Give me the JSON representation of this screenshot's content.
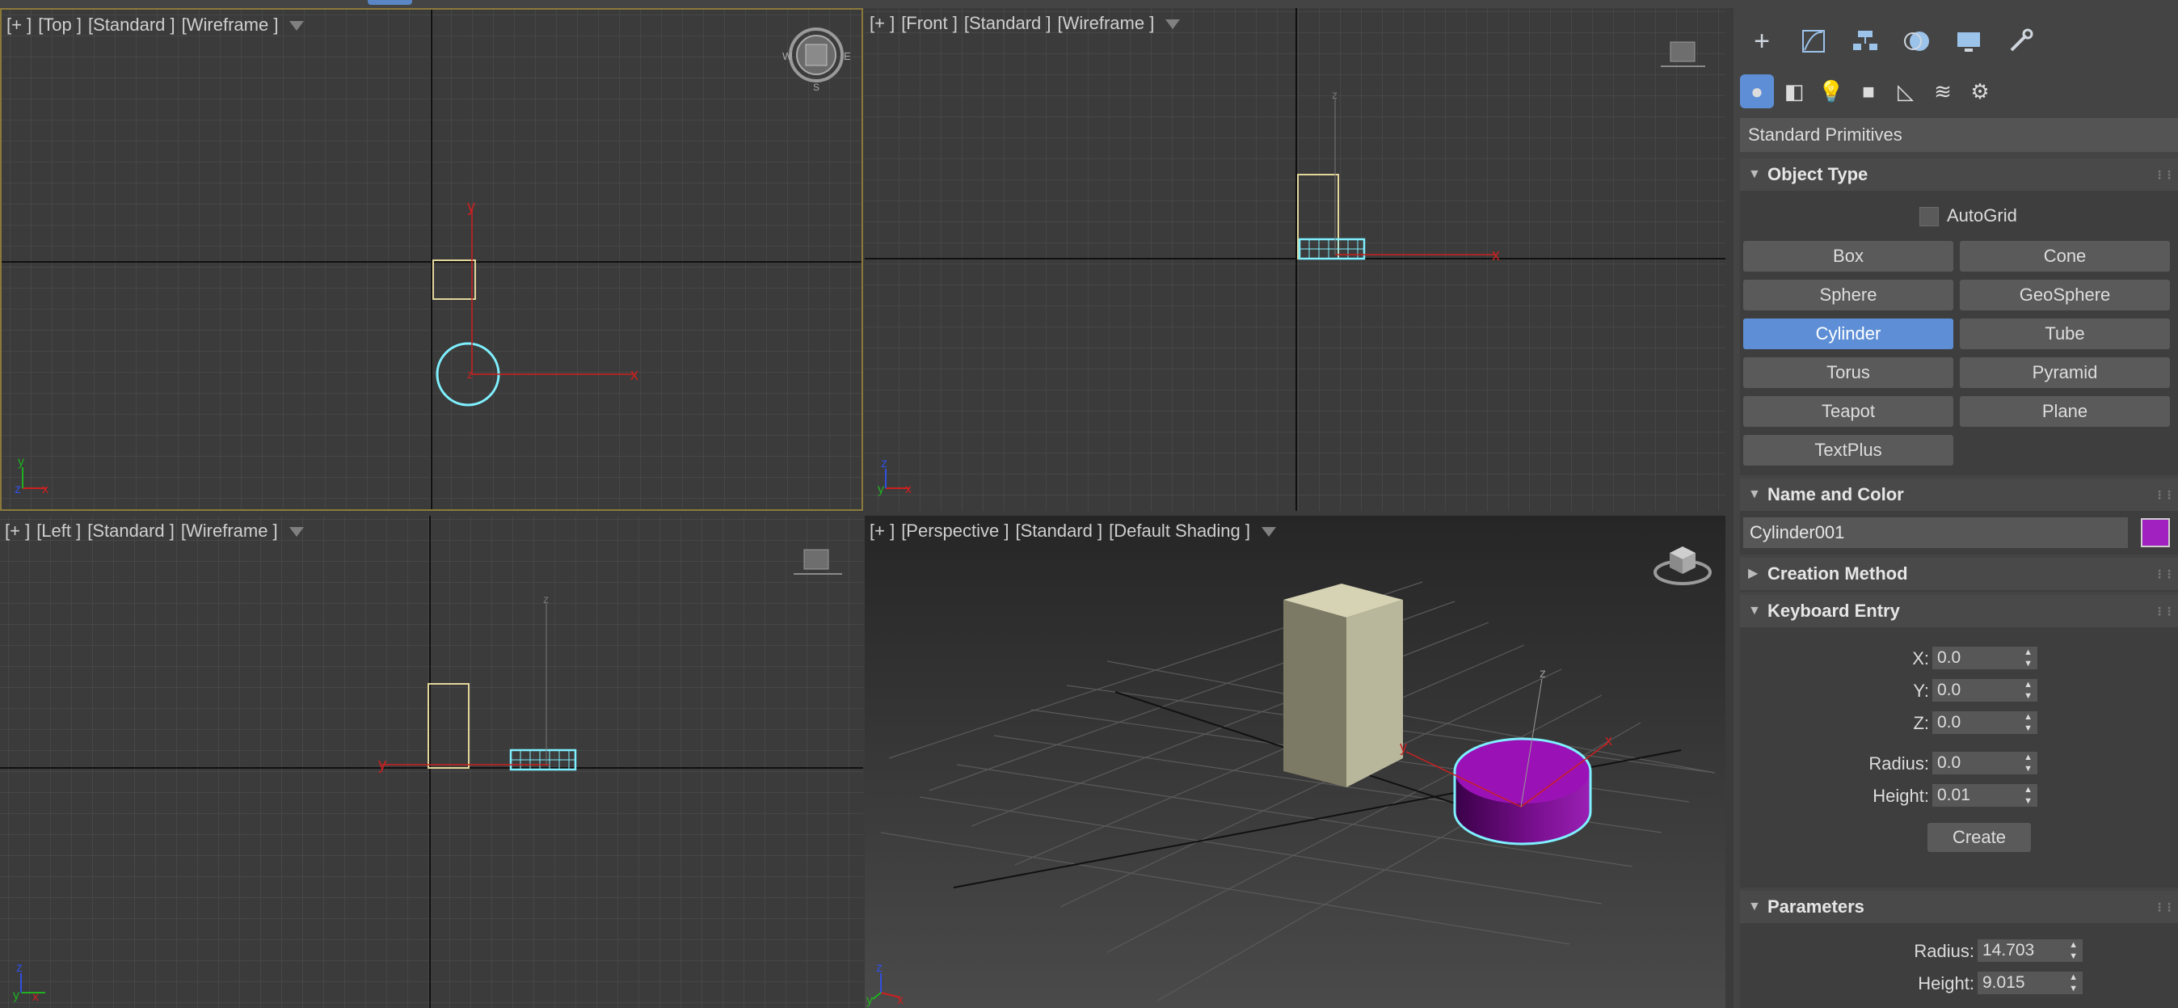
{
  "viewports": {
    "top": {
      "plus": "[+ ]",
      "view": "[Top ]",
      "shading": "[Standard ]",
      "mode": "[Wireframe ]"
    },
    "front": {
      "plus": "[+ ]",
      "view": "[Front ]",
      "shading": "[Standard ]",
      "mode": "[Wireframe ]"
    },
    "left": {
      "plus": "[+ ]",
      "view": "[Left ]",
      "shading": "[Standard ]",
      "mode": "[Wireframe ]"
    },
    "perspective": {
      "plus": "[+ ]",
      "view": "[Perspective ]",
      "shading": "[Standard ]",
      "mode": "[Default Shading ]"
    }
  },
  "axis_labels": {
    "x": "x",
    "y": "y",
    "z": "z"
  },
  "viewcube": {
    "w": "W",
    "e": "E",
    "s": "S"
  },
  "panel": {
    "main_tabs": [
      "create-icon",
      "modify-icon",
      "hierarchy-icon",
      "motion-icon",
      "display-icon",
      "utilities-icon"
    ],
    "sub_tabs": [
      "geometry-icon",
      "shapes-icon",
      "lights-icon",
      "cameras-icon",
      "helpers-icon",
      "space-warps-icon",
      "systems-icon"
    ],
    "category": "Standard Primitives",
    "object_type": {
      "title": "Object Type",
      "autogrid": "AutoGrid",
      "buttons": [
        "Box",
        "Cone",
        "Sphere",
        "GeoSphere",
        "Cylinder",
        "Tube",
        "Torus",
        "Pyramid",
        "Teapot",
        "Plane",
        "TextPlus"
      ],
      "selected": "Cylinder"
    },
    "name_and_color": {
      "title": "Name and Color",
      "name": "Cylinder001",
      "color": "#a020c0"
    },
    "creation_method": {
      "title": "Creation Method"
    },
    "keyboard_entry": {
      "title": "Keyboard Entry",
      "x_label": "X:",
      "x": "0.0",
      "y_label": "Y:",
      "y": "0.0",
      "z_label": "Z:",
      "z": "0.0",
      "radius_label": "Radius:",
      "radius": "0.0",
      "height_label": "Height:",
      "height": "0.01",
      "create": "Create"
    },
    "parameters": {
      "title": "Parameters",
      "radius_label": "Radius:",
      "radius": "14.703",
      "height_label": "Height:",
      "height": "9.015"
    }
  },
  "colors": {
    "accent": "#5e8fd6",
    "selection": "#7ff0ff",
    "box_edge": "#e2d69a",
    "axis": "#cc2020"
  }
}
